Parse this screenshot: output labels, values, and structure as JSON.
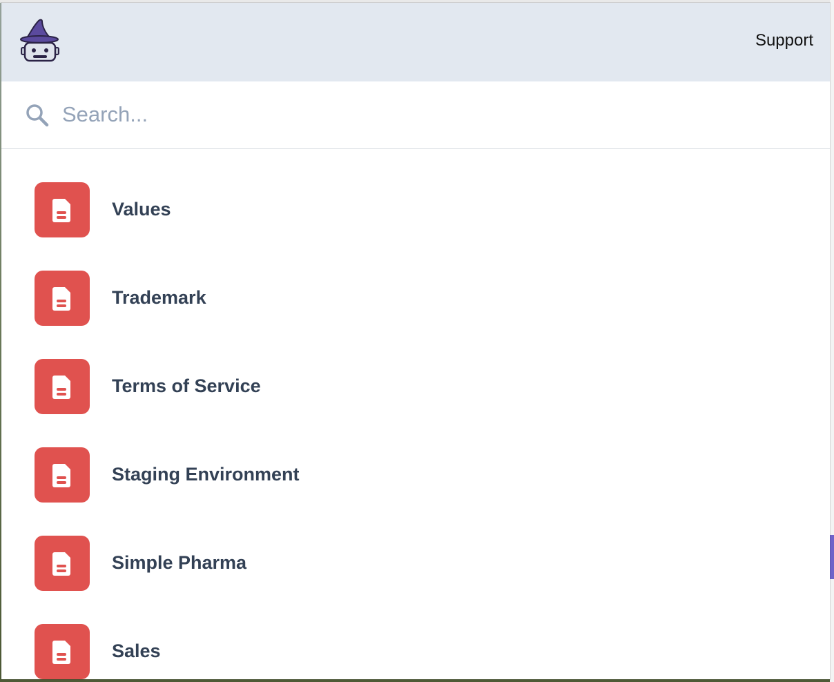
{
  "header": {
    "logo": "wizard-logo",
    "support_label": "Support"
  },
  "search": {
    "placeholder": "Search...",
    "value": "",
    "icon": "search-icon"
  },
  "items": [
    {
      "label": "Values",
      "icon": "document-icon"
    },
    {
      "label": "Trademark",
      "icon": "document-icon"
    },
    {
      "label": "Terms of Service",
      "icon": "document-icon"
    },
    {
      "label": "Staging Environment",
      "icon": "document-icon"
    },
    {
      "label": "Simple Pharma",
      "icon": "document-icon"
    },
    {
      "label": "Sales",
      "icon": "document-icon"
    }
  ],
  "colors": {
    "header_bg": "#e2e8f0",
    "item_icon_bg": "#e0524f",
    "item_text": "#334155",
    "placeholder": "#94a3b8"
  }
}
